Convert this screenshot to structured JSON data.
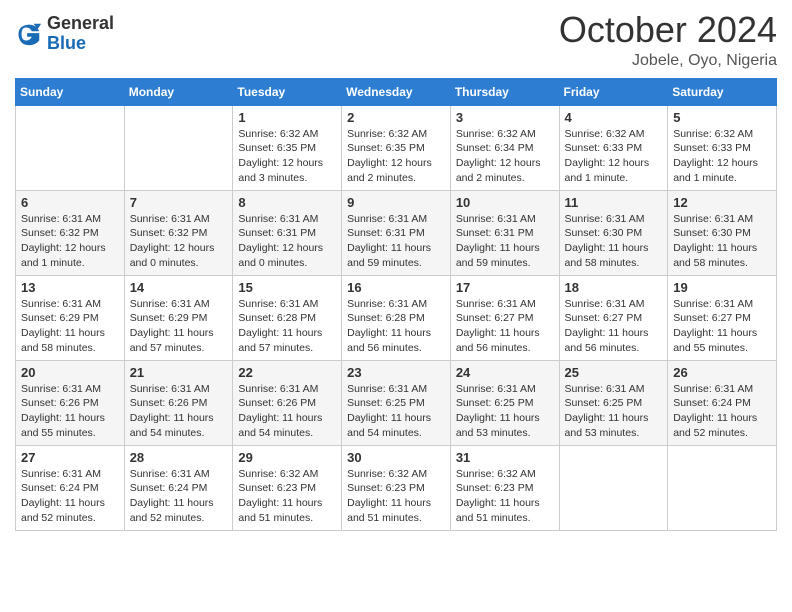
{
  "logo": {
    "general": "General",
    "blue": "Blue"
  },
  "header": {
    "month": "October 2024",
    "location": "Jobele, Oyo, Nigeria"
  },
  "weekdays": [
    "Sunday",
    "Monday",
    "Tuesday",
    "Wednesday",
    "Thursday",
    "Friday",
    "Saturday"
  ],
  "weeks": [
    [
      {
        "day": null,
        "detail": ""
      },
      {
        "day": null,
        "detail": ""
      },
      {
        "day": "1",
        "detail": "Sunrise: 6:32 AM\nSunset: 6:35 PM\nDaylight: 12 hours and 3 minutes."
      },
      {
        "day": "2",
        "detail": "Sunrise: 6:32 AM\nSunset: 6:35 PM\nDaylight: 12 hours and 2 minutes."
      },
      {
        "day": "3",
        "detail": "Sunrise: 6:32 AM\nSunset: 6:34 PM\nDaylight: 12 hours and 2 minutes."
      },
      {
        "day": "4",
        "detail": "Sunrise: 6:32 AM\nSunset: 6:33 PM\nDaylight: 12 hours and 1 minute."
      },
      {
        "day": "5",
        "detail": "Sunrise: 6:32 AM\nSunset: 6:33 PM\nDaylight: 12 hours and 1 minute."
      }
    ],
    [
      {
        "day": "6",
        "detail": "Sunrise: 6:31 AM\nSunset: 6:32 PM\nDaylight: 12 hours and 1 minute."
      },
      {
        "day": "7",
        "detail": "Sunrise: 6:31 AM\nSunset: 6:32 PM\nDaylight: 12 hours and 0 minutes."
      },
      {
        "day": "8",
        "detail": "Sunrise: 6:31 AM\nSunset: 6:31 PM\nDaylight: 12 hours and 0 minutes."
      },
      {
        "day": "9",
        "detail": "Sunrise: 6:31 AM\nSunset: 6:31 PM\nDaylight: 11 hours and 59 minutes."
      },
      {
        "day": "10",
        "detail": "Sunrise: 6:31 AM\nSunset: 6:31 PM\nDaylight: 11 hours and 59 minutes."
      },
      {
        "day": "11",
        "detail": "Sunrise: 6:31 AM\nSunset: 6:30 PM\nDaylight: 11 hours and 58 minutes."
      },
      {
        "day": "12",
        "detail": "Sunrise: 6:31 AM\nSunset: 6:30 PM\nDaylight: 11 hours and 58 minutes."
      }
    ],
    [
      {
        "day": "13",
        "detail": "Sunrise: 6:31 AM\nSunset: 6:29 PM\nDaylight: 11 hours and 58 minutes."
      },
      {
        "day": "14",
        "detail": "Sunrise: 6:31 AM\nSunset: 6:29 PM\nDaylight: 11 hours and 57 minutes."
      },
      {
        "day": "15",
        "detail": "Sunrise: 6:31 AM\nSunset: 6:28 PM\nDaylight: 11 hours and 57 minutes."
      },
      {
        "day": "16",
        "detail": "Sunrise: 6:31 AM\nSunset: 6:28 PM\nDaylight: 11 hours and 56 minutes."
      },
      {
        "day": "17",
        "detail": "Sunrise: 6:31 AM\nSunset: 6:27 PM\nDaylight: 11 hours and 56 minutes."
      },
      {
        "day": "18",
        "detail": "Sunrise: 6:31 AM\nSunset: 6:27 PM\nDaylight: 11 hours and 56 minutes."
      },
      {
        "day": "19",
        "detail": "Sunrise: 6:31 AM\nSunset: 6:27 PM\nDaylight: 11 hours and 55 minutes."
      }
    ],
    [
      {
        "day": "20",
        "detail": "Sunrise: 6:31 AM\nSunset: 6:26 PM\nDaylight: 11 hours and 55 minutes."
      },
      {
        "day": "21",
        "detail": "Sunrise: 6:31 AM\nSunset: 6:26 PM\nDaylight: 11 hours and 54 minutes."
      },
      {
        "day": "22",
        "detail": "Sunrise: 6:31 AM\nSunset: 6:26 PM\nDaylight: 11 hours and 54 minutes."
      },
      {
        "day": "23",
        "detail": "Sunrise: 6:31 AM\nSunset: 6:25 PM\nDaylight: 11 hours and 54 minutes."
      },
      {
        "day": "24",
        "detail": "Sunrise: 6:31 AM\nSunset: 6:25 PM\nDaylight: 11 hours and 53 minutes."
      },
      {
        "day": "25",
        "detail": "Sunrise: 6:31 AM\nSunset: 6:25 PM\nDaylight: 11 hours and 53 minutes."
      },
      {
        "day": "26",
        "detail": "Sunrise: 6:31 AM\nSunset: 6:24 PM\nDaylight: 11 hours and 52 minutes."
      }
    ],
    [
      {
        "day": "27",
        "detail": "Sunrise: 6:31 AM\nSunset: 6:24 PM\nDaylight: 11 hours and 52 minutes."
      },
      {
        "day": "28",
        "detail": "Sunrise: 6:31 AM\nSunset: 6:24 PM\nDaylight: 11 hours and 52 minutes."
      },
      {
        "day": "29",
        "detail": "Sunrise: 6:32 AM\nSunset: 6:23 PM\nDaylight: 11 hours and 51 minutes."
      },
      {
        "day": "30",
        "detail": "Sunrise: 6:32 AM\nSunset: 6:23 PM\nDaylight: 11 hours and 51 minutes."
      },
      {
        "day": "31",
        "detail": "Sunrise: 6:32 AM\nSunset: 6:23 PM\nDaylight: 11 hours and 51 minutes."
      },
      {
        "day": null,
        "detail": ""
      },
      {
        "day": null,
        "detail": ""
      }
    ]
  ]
}
